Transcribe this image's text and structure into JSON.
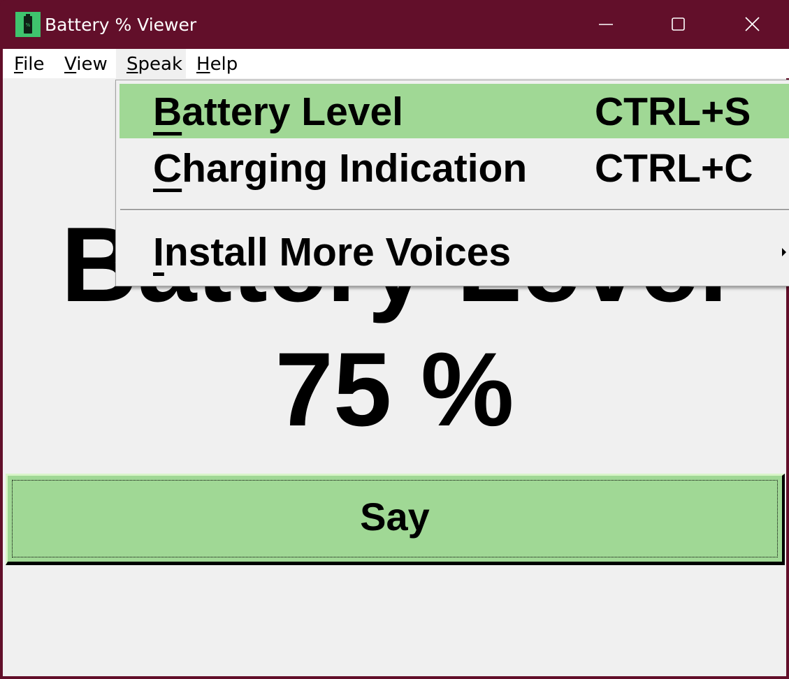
{
  "window": {
    "title": "Battery % Viewer",
    "titlebar_color": "#620f2a",
    "icon": "battery-app-icon",
    "icon_glyph": "%"
  },
  "menubar": {
    "items": [
      {
        "mnemonic": "F",
        "rest": "ile"
      },
      {
        "mnemonic": "V",
        "rest": "iew"
      },
      {
        "mnemonic": "S",
        "rest": "peak"
      },
      {
        "mnemonic": "H",
        "rest": "elp"
      }
    ],
    "open_menu": "Speak"
  },
  "speak_menu": {
    "items": [
      {
        "mnemonic": "B",
        "rest": "attery Level",
        "shortcut": "CTRL+S",
        "highlighted": true
      },
      {
        "mnemonic": "C",
        "rest": "harging Indication",
        "shortcut": "CTRL+C",
        "highlighted": false
      },
      {
        "mnemonic": "I",
        "rest": "nstall More Voices",
        "shortcut": "",
        "has_submenu": true
      }
    ],
    "highlight_color": "#a0d895"
  },
  "main": {
    "label": "Battery Level",
    "percent": "75 %",
    "say_button": "Say",
    "button_color": "#a0d895",
    "background": "#f0f0f0"
  }
}
